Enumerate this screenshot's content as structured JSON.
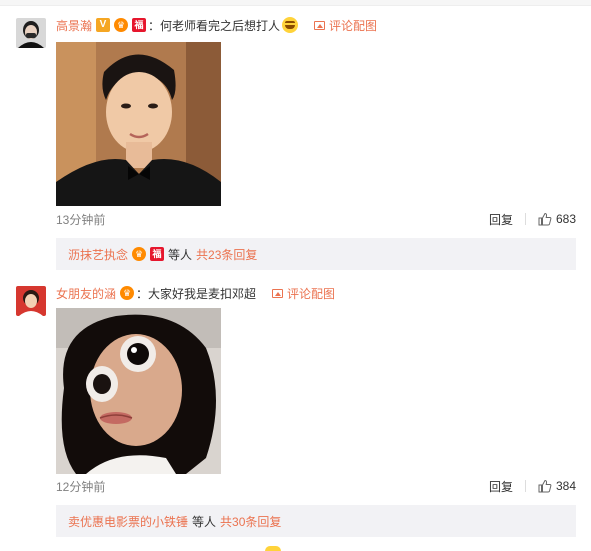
{
  "comments": [
    {
      "username": "高景瀚",
      "text": "何老师看完之后想打人",
      "pic_link": "评论配图",
      "time": "13分钟前",
      "reply_label": "回复",
      "likes": "683",
      "sub": {
        "name": "沥抹艺执念",
        "etc": "等人",
        "total": "共23条回复"
      },
      "icons": [
        "verified-v-icon",
        "fan-badge-icon",
        "red-envelope-icon",
        "laughing-emoji-icon"
      ]
    },
    {
      "username": "女朋友的涵",
      "text": "大家好我是麦扣邓超",
      "pic_link": "评论配图",
      "time": "12分钟前",
      "reply_label": "回复",
      "likes": "384",
      "sub": {
        "name": "卖优惠电影票的小铁锤",
        "etc": "等人",
        "total": "共30条回复"
      },
      "icons": [
        "fan-badge-icon"
      ]
    }
  ],
  "colors": {
    "accent": "#eb7350",
    "subbox_bg": "#f2f2f5",
    "meta": "#808080"
  }
}
